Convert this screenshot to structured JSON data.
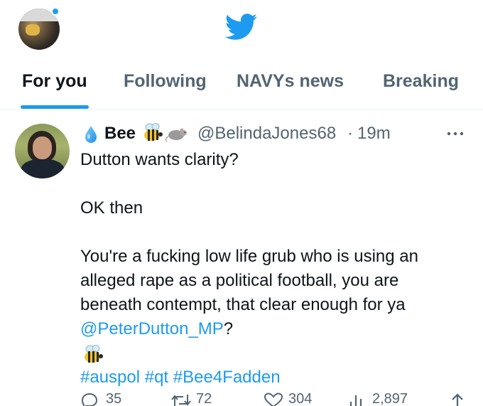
{
  "header": {
    "profile_avatar": "user-avatar",
    "logo": "twitter-bird-icon",
    "accent_color": "#1d9bf0"
  },
  "tabs": [
    {
      "label": "For you",
      "active": true
    },
    {
      "label": "Following",
      "active": false
    },
    {
      "label": "NAVYs news",
      "active": false
    },
    {
      "label": "Breaking",
      "active": false
    }
  ],
  "tweet": {
    "display_name": "Bee",
    "name_emojis": [
      "drop-icon",
      "bee-emoji",
      "rat-emoji"
    ],
    "handle": "@BelindaJones68",
    "separator": "·",
    "time": "19m",
    "lines": {
      "l1": "Dutton wants clarity?",
      "l2": "OK then",
      "l3": "You're a fucking low life grub who is using an",
      "l4": "alleged rape as a political football, you are",
      "l5": "beneath contempt, that clear enough for ya",
      "mention": "@PeterDutton_MP",
      "after_mention": "?",
      "hashtags": "#auspol #qt #Bee4Fadden"
    },
    "actions": {
      "replies": "35",
      "retweets": "72",
      "likes": "304",
      "views": "2,897"
    }
  }
}
